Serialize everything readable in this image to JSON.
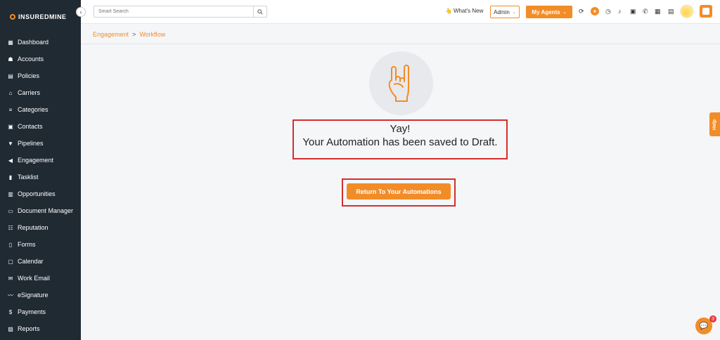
{
  "app": {
    "logo_text": "INSUREDMINE"
  },
  "sidebar": {
    "items": [
      {
        "label": "Dashboard",
        "icon": "dashboard-icon"
      },
      {
        "label": "Accounts",
        "icon": "accounts-icon"
      },
      {
        "label": "Policies",
        "icon": "policies-icon"
      },
      {
        "label": "Carriers",
        "icon": "carriers-icon"
      },
      {
        "label": "Categories",
        "icon": "categories-icon"
      },
      {
        "label": "Contacts",
        "icon": "contacts-icon"
      },
      {
        "label": "Pipelines",
        "icon": "pipelines-icon"
      },
      {
        "label": "Engagement",
        "icon": "engagement-icon"
      },
      {
        "label": "Tasklist",
        "icon": "tasklist-icon"
      },
      {
        "label": "Opportunities",
        "icon": "opportunities-icon"
      },
      {
        "label": "Document Manager",
        "icon": "folder-icon"
      },
      {
        "label": "Reputation",
        "icon": "reputation-icon"
      },
      {
        "label": "Forms",
        "icon": "forms-icon"
      },
      {
        "label": "Calendar",
        "icon": "calendar-icon"
      },
      {
        "label": "Work Email",
        "icon": "email-icon"
      },
      {
        "label": "eSignature",
        "icon": "signature-icon"
      },
      {
        "label": "Payments",
        "icon": "payments-icon"
      },
      {
        "label": "Reports",
        "icon": "reports-icon"
      }
    ]
  },
  "header": {
    "search_placeholder": "Smart Search",
    "whats_new": "What's New",
    "admin_label": "Admin",
    "my_agents_label": "My Agents"
  },
  "breadcrumb": {
    "parent": "Engagement",
    "separator": ">",
    "current": "Workflow"
  },
  "main": {
    "title": "Yay!",
    "message": "Your Automation has been saved to Draft.",
    "return_button": "Return To Your Automations"
  },
  "help_label": "Help",
  "chat": {
    "badge_count": "3"
  },
  "colors": {
    "accent": "#f28c28",
    "sidebar_bg": "#1f2a33",
    "highlight": "#d32f2f"
  }
}
